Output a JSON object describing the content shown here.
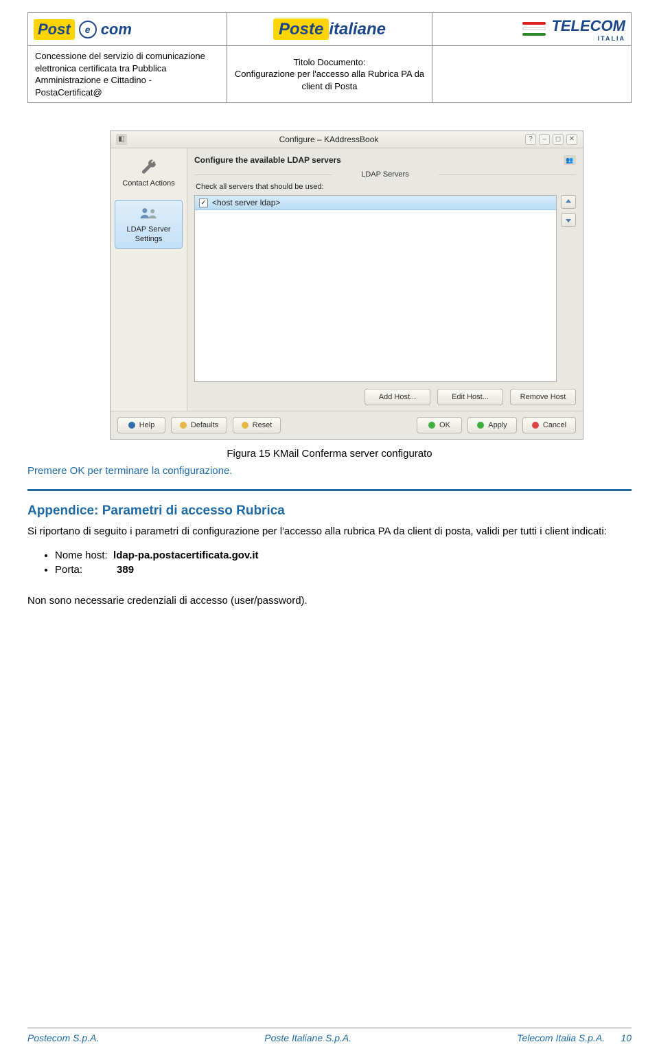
{
  "header": {
    "left_info": "Concessione del servizio di comunicazione elettronica certificata tra Pubblica Amministrazione e Cittadino - PostaCertificat@",
    "center_label": "Titolo Documento:",
    "center_text": "Configurazione per l'accesso alla Rubrica PA da client di Posta",
    "logos": {
      "postecom": "Post e com",
      "posteitaliane_yellow": "Poste",
      "posteitaliane_rest": "italiane",
      "telecom": "TELECOM",
      "telecom_sub": "ITALIA"
    }
  },
  "dialog": {
    "title": "Configure – KAddressBook",
    "win_btns": {
      "help": "?",
      "min": "–",
      "max": "◻",
      "close": "✕"
    },
    "sidebar": {
      "item1": "Contact Actions",
      "item2": "LDAP Server Settings"
    },
    "pane_title": "Configure the available LDAP servers",
    "group_label": "LDAP Servers",
    "hint": "Check all servers that should be used:",
    "list_entry": "<host server ldap>",
    "host_btns": {
      "add": "Add Host...",
      "edit": "Edit Host...",
      "remove": "Remove Host"
    },
    "footer_btns": {
      "help": "Help",
      "defaults": "Defaults",
      "reset": "Reset",
      "ok": "OK",
      "apply": "Apply",
      "cancel": "Cancel"
    }
  },
  "caption": "Figura 15 KMail Conferma server configurato",
  "text1": "Premere OK per terminare la configurazione.",
  "appendix": {
    "title": "Appendice: Parametri di accesso Rubrica",
    "para": "Si riportano di seguito i parametri di configurazione per l'accesso alla rubrica PA da client di posta, validi per tutti i client indicati:",
    "host_label": "Nome host:",
    "host_value": "ldap-pa.postacertificata.gov.it",
    "port_label": "Porta:",
    "port_value": "389",
    "note": "Non sono necessarie credenziali di accesso (user/password)."
  },
  "footer": {
    "left": "Postecom  S.p.A.",
    "center": "Poste Italiane S.p.A.",
    "right": "Telecom Italia S.p.A.",
    "page": "10"
  }
}
